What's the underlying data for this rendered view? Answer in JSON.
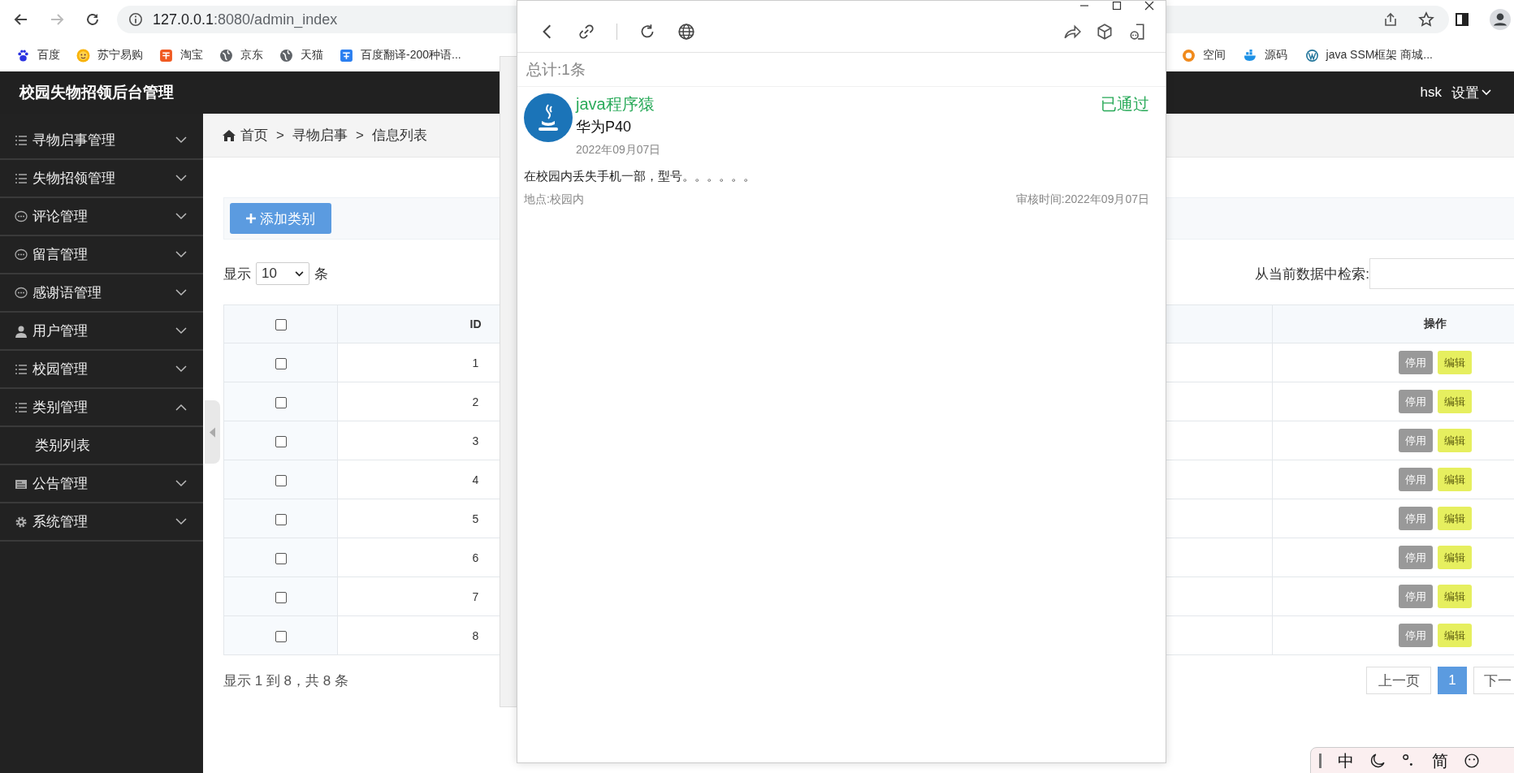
{
  "browser": {
    "url_host": "127.0.0.1",
    "url_path": ":8080/admin_index",
    "bookmarks": [
      {
        "label": "百度",
        "kind": "paw"
      },
      {
        "label": "苏宁易购",
        "kind": "smiley"
      },
      {
        "label": "淘宝",
        "kind": "shop"
      },
      {
        "label": "京东",
        "kind": "globe"
      },
      {
        "label": "天猫",
        "kind": "globe"
      },
      {
        "label": "百度翻译-200种语...",
        "kind": "translate"
      }
    ],
    "bookmarks_right": [
      {
        "label": "空间",
        "kind": "star"
      },
      {
        "label": "源码",
        "kind": "whale"
      },
      {
        "label": "java SSM框架 商城...",
        "kind": "wordpress"
      }
    ]
  },
  "app": {
    "title": "校园失物招领后台管理",
    "user": "hsk",
    "settings": "设置"
  },
  "sidebar": {
    "items": [
      {
        "label": "寻物启事管理",
        "kind": "list",
        "expanded": false
      },
      {
        "label": "失物招领管理",
        "kind": "list",
        "expanded": false
      },
      {
        "label": "评论管理",
        "kind": "chat",
        "expanded": false
      },
      {
        "label": "留言管理",
        "kind": "chat",
        "expanded": false
      },
      {
        "label": "感谢语管理",
        "kind": "chat",
        "expanded": false
      },
      {
        "label": "用户管理",
        "kind": "user",
        "expanded": false
      },
      {
        "label": "校园管理",
        "kind": "list",
        "expanded": false
      },
      {
        "label": "类别管理",
        "kind": "list",
        "expanded": true,
        "children": [
          {
            "label": "类别列表"
          }
        ]
      },
      {
        "label": "公告管理",
        "kind": "notice",
        "expanded": false
      },
      {
        "label": "系统管理",
        "kind": "gear",
        "expanded": false
      }
    ]
  },
  "breadcrumb": [
    "首页",
    "寻物启事",
    "信息列表"
  ],
  "breadcrumb_separator": ">",
  "toolbar": {
    "add_button": "添加类别"
  },
  "page_size": {
    "prefix": "显示",
    "value": "10",
    "suffix": "条"
  },
  "search": {
    "label": "从当前数据中检索:"
  },
  "table": {
    "columns": [
      {
        "kind": "checkbox",
        "checked": false
      },
      {
        "kind": "text",
        "label": "ID"
      },
      {
        "kind": "blank"
      },
      {
        "kind": "text",
        "label": "操作"
      }
    ],
    "rows": [
      {
        "checked": false,
        "id": "1",
        "actions": [
          {
            "label": "停用",
            "kind": "disable"
          },
          {
            "label": "编辑",
            "kind": "edit"
          }
        ]
      },
      {
        "checked": false,
        "id": "2",
        "actions": [
          {
            "label": "停用",
            "kind": "disable"
          },
          {
            "label": "编辑",
            "kind": "edit"
          }
        ]
      },
      {
        "checked": false,
        "id": "3",
        "actions": [
          {
            "label": "停用",
            "kind": "disable"
          },
          {
            "label": "编辑",
            "kind": "edit"
          }
        ]
      },
      {
        "checked": false,
        "id": "4",
        "actions": [
          {
            "label": "停用",
            "kind": "disable"
          },
          {
            "label": "编辑",
            "kind": "edit"
          }
        ]
      },
      {
        "checked": false,
        "id": "5",
        "actions": [
          {
            "label": "停用",
            "kind": "disable"
          },
          {
            "label": "编辑",
            "kind": "edit"
          }
        ]
      },
      {
        "checked": false,
        "id": "6",
        "actions": [
          {
            "label": "停用",
            "kind": "disable"
          },
          {
            "label": "编辑",
            "kind": "edit"
          }
        ]
      },
      {
        "checked": false,
        "id": "7",
        "actions": [
          {
            "label": "停用",
            "kind": "disable"
          },
          {
            "label": "编辑",
            "kind": "edit"
          }
        ]
      },
      {
        "checked": false,
        "id": "8",
        "actions": [
          {
            "label": "停用",
            "kind": "disable"
          },
          {
            "label": "编辑",
            "kind": "edit"
          }
        ]
      }
    ]
  },
  "table_info": "显示 1 到 8，共 8 条",
  "pagination": [
    {
      "label": "上一页",
      "kind": "prev",
      "selected": false
    },
    {
      "label": "1",
      "kind": "page",
      "selected": true
    },
    {
      "label": "下一",
      "kind": "next",
      "selected": false
    }
  ],
  "popup": {
    "total": "总计:1条",
    "posts": [
      {
        "author": "java程序猿",
        "status": "已通过",
        "title": "华为P40",
        "date": "2022年09月07日",
        "description": "在校园内丢失手机一部，型号。。。。。。",
        "location": "地点:校园内",
        "review_time": "审核时间:2022年09月07日"
      }
    ]
  },
  "ime": {
    "mode": "中",
    "script": "简"
  }
}
